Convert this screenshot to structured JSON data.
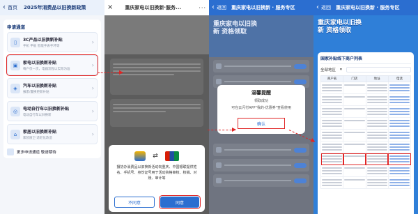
{
  "panel1": {
    "back_label": "首页",
    "title": "2025年消费品以旧换新政策",
    "section": "申请通道",
    "cards": [
      {
        "name": "3C产品以旧换新补贴",
        "sub": "手机 平板 智能手表手环等",
        "icon": "phone-icon"
      },
      {
        "name": "家电以旧换新补贴",
        "sub": "每户仅一次，电器流程以实际为准",
        "icon": "appliance-icon"
      },
      {
        "name": "汽车以旧换新补贴",
        "sub": "报废/置换更新补贴",
        "icon": "car-icon"
      },
      {
        "name": "电动自行车以旧换新补贴",
        "sub": "电动自行车以旧换新",
        "icon": "bike-icon"
      },
      {
        "name": "家居以旧换新补贴",
        "sub": "家装厨卫 适老化改造",
        "icon": "home-icon"
      }
    ],
    "more_label": "更多申请通道 敬请期待"
  },
  "panel2": {
    "title": "重庆家电以旧换新·服务...",
    "dialog_text": "摄协办消费品以旧换新活动向重庆、中国银联提供姓名、手机号、身份证号用于活动资格审核、核销、对账、审计等",
    "cancel_label": "不同意",
    "agree_label": "同意"
  },
  "panel3": {
    "back_label": "返回",
    "title": "重庆家电以旧换新 · 服务专区",
    "banner": "重庆家电以旧换新 资格领取",
    "dialog_title": "温馨提醒",
    "dialog_line1": "领取成功",
    "dialog_line2": "可在云闪付APP\"我的-优惠券\"查看使用",
    "confirm_label": "确认"
  },
  "panel4": {
    "back_label": "返回",
    "title": "重庆家电以旧换新 · 服务专区",
    "banner": "重庆家电以旧换新 资格领取",
    "card_title": "国家补贴线下商户列表",
    "filter_label": "全部地区",
    "columns": [
      "商户名",
      "门店",
      "地址",
      "电话"
    ],
    "row_count": 9,
    "highlight_row": 6
  },
  "colors": {
    "accent": "#2b6ed0",
    "highlight": "#e02525"
  }
}
